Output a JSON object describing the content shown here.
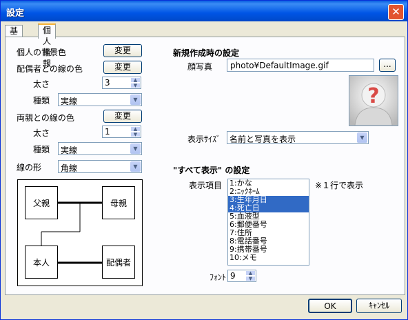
{
  "window": {
    "title": "設定",
    "close_glyph": "✕"
  },
  "tabs": [
    {
      "label": "基本"
    },
    {
      "label": "個人情報"
    }
  ],
  "left": {
    "person_bg_label": "個人の背景色",
    "change_label": "変更",
    "spouse_line_label": "配偶者との線の色",
    "thickness_label": "太さ",
    "spouse_thickness": "3",
    "type_label": "種類",
    "spouse_type": "実線",
    "parents_line_label": "両親との線の色",
    "parents_thickness": "1",
    "parents_type": "実線",
    "line_shape_label": "線の形",
    "line_shape": "角線"
  },
  "diagram": {
    "father": "父親",
    "mother": "母親",
    "self": "本人",
    "spouse": "配偶者"
  },
  "right": {
    "new_settings_title": "新規作成時の設定",
    "photo_label": "顔写真",
    "photo_path": "photo¥DefaultImage.gif",
    "browse_label": "...",
    "display_size_label": "表示ｻｲｽﾞ",
    "display_size_value": "名前と写真を表示",
    "show_all_title": "\"すべて表示\" の設定",
    "display_items_label": "表示項目",
    "one_line_note": "※１行で表示",
    "font_label": "ﾌｫﾝﾄ",
    "font_value": "9",
    "items": [
      {
        "label": "1:かな",
        "selected": false
      },
      {
        "label": "2:ﾆｯｸﾈｰﾑ",
        "selected": false
      },
      {
        "label": "3:生年月日",
        "selected": true
      },
      {
        "label": "4:死亡日",
        "selected": true
      },
      {
        "label": "5:血液型",
        "selected": false
      },
      {
        "label": "6:郵便番号",
        "selected": false
      },
      {
        "label": "7:住所",
        "selected": false
      },
      {
        "label": "8:電話番号",
        "selected": false
      },
      {
        "label": "9:携帯番号",
        "selected": false
      },
      {
        "label": "10:メモ",
        "selected": false
      }
    ]
  },
  "footer": {
    "ok": "OK",
    "cancel": "ｷｬﾝｾﾙ"
  },
  "colors": {
    "accent": "#316ac5",
    "titlebar": "#0055e5",
    "photo_placeholder": "#d94a46"
  },
  "icons": {
    "close": "close-icon",
    "spin_up": "arrow-up-icon",
    "spin_down": "arrow-down-icon",
    "dropdown": "chevron-down-icon",
    "photo": "person-question-icon"
  }
}
